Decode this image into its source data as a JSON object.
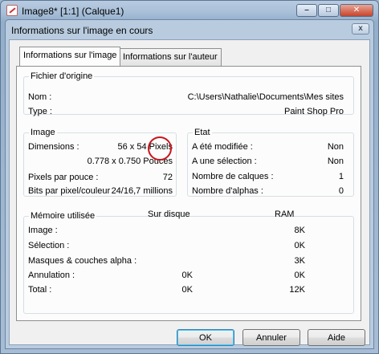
{
  "background_window": {
    "title": "Image8* [1:1] (Calque1)",
    "buttons": [
      "minimize",
      "maximize",
      "close"
    ]
  },
  "dialog": {
    "title": "Informations sur l'image en cours",
    "close_glyph": "x"
  },
  "tabs": [
    {
      "label": "Informations sur l'image",
      "active": true
    },
    {
      "label": "Informations sur l'auteur",
      "active": false
    }
  ],
  "source_file": {
    "legend": "Fichier d'origine",
    "name_label": "Nom :",
    "name_value": "C:\\Users\\Nathalie\\Documents\\Mes sites",
    "type_label": "Type :",
    "type_value": "Paint Shop Pro"
  },
  "image": {
    "legend": "Image",
    "dimensions_label": "Dimensions :",
    "dimensions_pixels": "56 x 54 Pixels",
    "dimensions_inches": "0.778 x 0.750 Pouces",
    "ppi_label": "Pixels par pouce :",
    "ppi_value": "72",
    "bpp_label": "Bits par pixel/couleur",
    "bpp_value": "24/16,7 millions"
  },
  "state": {
    "legend": "Etat",
    "rows": [
      {
        "label": "A été modifiée :",
        "value": "Non"
      },
      {
        "label": "A une sélection :",
        "value": "Non"
      },
      {
        "label": "Nombre de calques :",
        "value": "1"
      },
      {
        "label": "Nombre d'alphas :",
        "value": "0"
      }
    ]
  },
  "memory": {
    "legend": "Mémoire utilisée",
    "col_disk": "Sur disque",
    "col_ram": "RAM",
    "rows": [
      {
        "label": "Image :",
        "disk": "",
        "ram": "8K"
      },
      {
        "label": "Sélection :",
        "disk": "",
        "ram": "0K"
      },
      {
        "label": "Masques & couches alpha :",
        "disk": "",
        "ram": "3K"
      },
      {
        "label": "Annulation :",
        "disk": "0K",
        "ram": "0K"
      },
      {
        "label": "Total :",
        "disk": "0K",
        "ram": "12K"
      }
    ]
  },
  "buttons": {
    "ok": "OK",
    "cancel": "Annuler",
    "help": "Aide"
  },
  "annotation_color": "#c8161e"
}
